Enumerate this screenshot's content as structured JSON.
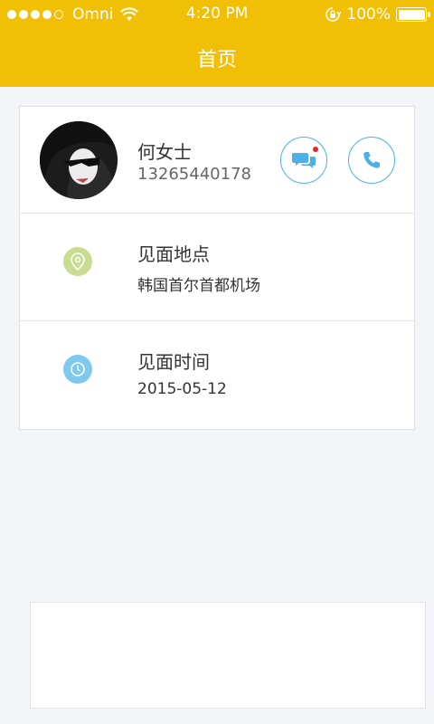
{
  "status_bar": {
    "carrier": "Omni",
    "time": "4:20 PM",
    "battery": "100%",
    "signal_dots": 5,
    "signal_filled": 4
  },
  "nav": {
    "title": "首页"
  },
  "contact": {
    "name": "何女士",
    "phone": "13265440178",
    "message_icon": "chat-bubbles-icon",
    "call_icon": "phone-icon",
    "unread_dot_color": "#e0262b"
  },
  "meeting_place": {
    "title": "见面地点",
    "value": "韩国首尔首都机场",
    "icon": "location-pin-icon",
    "icon_color": "#c9dc8f"
  },
  "meeting_time": {
    "title": "见面时间",
    "value": "2015-05-12",
    "icon": "clock-icon",
    "icon_color": "#7fc9ef"
  },
  "colors": {
    "accent_yellow": "#f1bf06",
    "button_blue": "#4bb0e8",
    "background": "#f3f5f8"
  }
}
